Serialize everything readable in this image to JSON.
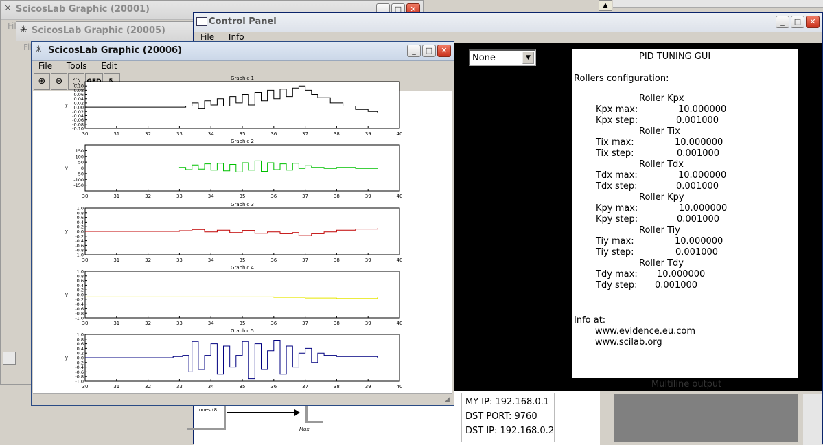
{
  "windows": {
    "bg1": {
      "title": "ScicosLab Graphic (20001)",
      "menu_fragment": "Fil"
    },
    "bg2": {
      "title": "ScicosLab Graphic (20005)",
      "menu_fragment": "Fil"
    },
    "control": {
      "title": "Control Panel",
      "menu": [
        "File",
        "Info"
      ]
    },
    "main": {
      "title": "ScicosLab Graphic (20006)",
      "menu": [
        "File",
        "Tools",
        "Edit"
      ],
      "toolbar": {
        "ged_label": "GED"
      }
    }
  },
  "dropdown": {
    "value": "None"
  },
  "pid": {
    "title": "PID TUNING GUI",
    "rollers_heading": "Rollers configuration:",
    "rollers": [
      {
        "name": "Roller Kpx",
        "max_label": "Kpx max:",
        "max_value": "10.000000",
        "step_label": "Kpx step:",
        "step_value": "0.001000"
      },
      {
        "name": "Roller Tix",
        "max_label": "Tix max:",
        "max_value": "10.000000",
        "step_label": "Tix step:",
        "step_value": "0.001000"
      },
      {
        "name": "Roller Tdx",
        "max_label": "Tdx max:",
        "max_value": "10.000000",
        "step_label": "Tdx step:",
        "step_value": "0.001000"
      },
      {
        "name": "Roller Kpy",
        "max_label": "Kpy max:",
        "max_value": "10.000000",
        "step_label": "Kpy step:",
        "step_value": "0.001000"
      },
      {
        "name": "Roller Tiy",
        "max_label": "Tiy max:",
        "max_value": "10.000000",
        "step_label": "Tiy step:",
        "step_value": "0.001000"
      },
      {
        "name": "Roller Tdy",
        "max_label": "Tdy max:",
        "max_value": "10.000000",
        "step_label": "Tdy step:",
        "step_value": "0.001000"
      }
    ],
    "info_heading": "Info at:",
    "links": [
      "www.evidence.eu.com",
      "www.scilab.org"
    ]
  },
  "multiline_label": "Multiline output",
  "network": {
    "my_ip": "MY IP: 192.168.0.1",
    "dst_port": "DST PORT: 9760",
    "dst_ip": "DST IP: 192.168.0.2"
  },
  "diagram": {
    "block_label": "ones (8...",
    "mux_label": "Mux"
  },
  "colors": {
    "plot1": "#000000",
    "plot2": "#00c000",
    "plot3": "#c00000",
    "plot4": "#e6e600",
    "plot5": "#000080",
    "control_dark": "#000000"
  },
  "chart_data": [
    {
      "type": "line",
      "title": "Graphic 1",
      "ylabel": "y",
      "xlim": [
        30,
        40
      ],
      "ylim": [
        -0.1,
        0.12
      ],
      "xticks": [
        30,
        31,
        32,
        33,
        34,
        35,
        36,
        37,
        38,
        39,
        40
      ],
      "yticks": [
        "-0.10",
        "-0.08",
        "-0.06",
        "-0.04",
        "-0.02",
        "0.00",
        "0.02",
        "0.04",
        "0.06",
        "0.08",
        "0.10"
      ],
      "series": [
        {
          "color": "#000000",
          "points": [
            [
              30.0,
              0.0
            ],
            [
              32.6,
              0.0
            ],
            [
              33.0,
              0.0
            ],
            [
              33.2,
              0.005
            ],
            [
              33.4,
              0.02
            ],
            [
              33.6,
              -0.005
            ],
            [
              33.8,
              0.03
            ],
            [
              34.0,
              0.01
            ],
            [
              34.2,
              0.04
            ],
            [
              34.4,
              0.005
            ],
            [
              34.6,
              0.05
            ],
            [
              34.8,
              0.02
            ],
            [
              35.0,
              0.06
            ],
            [
              35.2,
              0.01
            ],
            [
              35.4,
              0.07
            ],
            [
              35.6,
              0.03
            ],
            [
              35.8,
              0.08
            ],
            [
              36.0,
              0.04
            ],
            [
              36.2,
              0.085
            ],
            [
              36.4,
              0.05
            ],
            [
              36.6,
              0.09
            ],
            [
              36.8,
              0.1
            ],
            [
              37.0,
              0.08
            ],
            [
              37.2,
              0.06
            ],
            [
              37.4,
              0.045
            ],
            [
              37.8,
              0.02
            ],
            [
              38.2,
              0.005
            ],
            [
              38.6,
              -0.01
            ],
            [
              39.0,
              -0.02
            ],
            [
              39.3,
              -0.025
            ]
          ]
        }
      ]
    },
    {
      "type": "line",
      "title": "Graphic 2",
      "ylabel": "y",
      "xlim": [
        30,
        40
      ],
      "ylim": [
        -200,
        200
      ],
      "xticks": [
        30,
        31,
        32,
        33,
        34,
        35,
        36,
        37,
        38,
        39,
        40
      ],
      "yticks": [
        "-150",
        "-100",
        "-50",
        "0",
        "50",
        "100",
        "150"
      ],
      "series": [
        {
          "color": "#00c000",
          "points": [
            [
              30.0,
              0.0
            ],
            [
              32.6,
              0.0
            ],
            [
              33.0,
              5
            ],
            [
              33.2,
              -15
            ],
            [
              33.4,
              25
            ],
            [
              33.6,
              -10
            ],
            [
              33.8,
              35
            ],
            [
              34.0,
              -20
            ],
            [
              34.2,
              40
            ],
            [
              34.4,
              -25
            ],
            [
              34.6,
              30
            ],
            [
              34.8,
              -35
            ],
            [
              35.0,
              45
            ],
            [
              35.2,
              -20
            ],
            [
              35.4,
              60
            ],
            [
              35.6,
              -30
            ],
            [
              35.8,
              45
            ],
            [
              36.0,
              -15
            ],
            [
              36.2,
              35
            ],
            [
              36.4,
              -20
            ],
            [
              36.6,
              40
            ],
            [
              36.8,
              -5
            ],
            [
              37.0,
              20
            ],
            [
              37.2,
              5
            ],
            [
              37.6,
              -5
            ],
            [
              38.0,
              5
            ],
            [
              38.6,
              -5
            ],
            [
              39.3,
              0
            ]
          ]
        }
      ]
    },
    {
      "type": "line",
      "title": "Graphic 3",
      "ylabel": "y",
      "xlim": [
        30,
        40
      ],
      "ylim": [
        -1.0,
        1.0
      ],
      "xticks": [
        30,
        31,
        32,
        33,
        34,
        35,
        36,
        37,
        38,
        39,
        40
      ],
      "yticks": [
        "-1.0",
        "-0.8",
        "-0.6",
        "-0.4",
        "-0.2",
        "0.0",
        "0.2",
        "0.4",
        "0.6",
        "0.8",
        "1.0"
      ],
      "series": [
        {
          "color": "#c00000",
          "points": [
            [
              30.0,
              0.0
            ],
            [
              32.6,
              0.0
            ],
            [
              33.0,
              0.03
            ],
            [
              33.4,
              0.08
            ],
            [
              33.8,
              -0.02
            ],
            [
              34.2,
              0.05
            ],
            [
              34.6,
              -0.05
            ],
            [
              35.0,
              0.04
            ],
            [
              35.4,
              -0.08
            ],
            [
              35.8,
              -0.02
            ],
            [
              36.2,
              -0.1
            ],
            [
              36.6,
              -0.05
            ],
            [
              36.8,
              -0.18
            ],
            [
              37.2,
              -0.1
            ],
            [
              37.6,
              -0.02
            ],
            [
              38.0,
              0.05
            ],
            [
              38.6,
              0.1
            ],
            [
              39.3,
              0.13
            ]
          ]
        }
      ]
    },
    {
      "type": "line",
      "title": "Graphic 4",
      "ylabel": "y",
      "xlim": [
        30,
        40
      ],
      "ylim": [
        -1.0,
        1.0
      ],
      "xticks": [
        30,
        31,
        32,
        33,
        34,
        35,
        36,
        37,
        38,
        39,
        40
      ],
      "yticks": [
        "-1.0",
        "-0.8",
        "-0.6",
        "-0.4",
        "-0.2",
        "0.0",
        "0.2",
        "0.4",
        "0.6",
        "0.8",
        "1.0"
      ],
      "series": [
        {
          "color": "#e6e600",
          "points": [
            [
              30.0,
              -0.1
            ],
            [
              33.0,
              -0.1
            ],
            [
              35.0,
              -0.1
            ],
            [
              36.0,
              -0.12
            ],
            [
              37.0,
              -0.15
            ],
            [
              38.0,
              -0.17
            ],
            [
              39.3,
              -0.12
            ]
          ]
        }
      ]
    },
    {
      "type": "line",
      "title": "Graphic 5",
      "ylabel": "y",
      "xlim": [
        30,
        40
      ],
      "ylim": [
        -1.0,
        1.0
      ],
      "xticks": [
        30,
        31,
        32,
        33,
        34,
        35,
        36,
        37,
        38,
        39,
        40
      ],
      "yticks": [
        "-1.0",
        "-0.8",
        "-0.6",
        "-0.4",
        "-0.2",
        "0.0",
        "0.2",
        "0.4",
        "0.6",
        "0.8",
        "1.0"
      ],
      "series": [
        {
          "color": "#000080",
          "points": [
            [
              30.0,
              0.0
            ],
            [
              32.5,
              0.0
            ],
            [
              32.8,
              0.05
            ],
            [
              33.1,
              0.1
            ],
            [
              33.3,
              -0.6
            ],
            [
              33.4,
              0.7
            ],
            [
              33.6,
              -0.5
            ],
            [
              33.8,
              0.1
            ],
            [
              34.0,
              0.6
            ],
            [
              34.2,
              -0.7
            ],
            [
              34.4,
              0.5
            ],
            [
              34.6,
              -0.4
            ],
            [
              34.8,
              0.1
            ],
            [
              35.0,
              0.7
            ],
            [
              35.2,
              -0.9
            ],
            [
              35.4,
              0.6
            ],
            [
              35.6,
              -0.5
            ],
            [
              35.8,
              0.3
            ],
            [
              36.0,
              0.75
            ],
            [
              36.2,
              -0.7
            ],
            [
              36.4,
              0.5
            ],
            [
              36.6,
              -0.4
            ],
            [
              36.8,
              0.2
            ],
            [
              37.0,
              0.4
            ],
            [
              37.2,
              -0.2
            ],
            [
              37.4,
              0.2
            ],
            [
              37.6,
              0.1
            ],
            [
              38.0,
              0.05
            ],
            [
              38.6,
              0.05
            ],
            [
              39.3,
              0.0
            ]
          ]
        }
      ]
    }
  ]
}
